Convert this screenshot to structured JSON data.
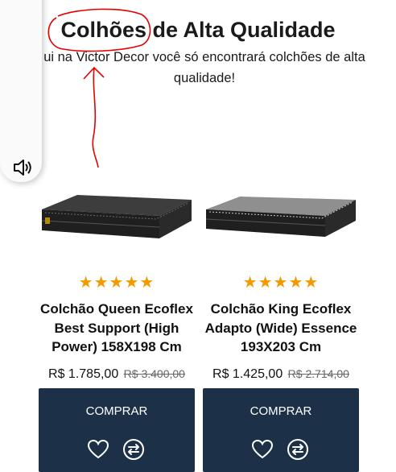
{
  "section": {
    "title": "Colhões de Alta Qualidade",
    "subtitle": "ui na Victor Decor você só encontrará colchões de alta qualidade!"
  },
  "side_panel": {
    "dots": "•••",
    "speaker_icon": "speaker-icon"
  },
  "products": [
    {
      "rating_stars": "★★★★★",
      "rating": 5,
      "name": "Colchão Queen Ecoflex Best Support (High Power) 158X198 Cm",
      "price": "R$ 1.785,00",
      "old_price": "R$ 3.400,00",
      "buy_label": "COMPRAR",
      "image_icon": "mattress-dark-image"
    },
    {
      "rating_stars": "★★★★★",
      "rating": 5,
      "name": "Colchão King Ecoflex Adapto (Wide) Essence 193X203 Cm",
      "price": "R$ 1.425,00",
      "old_price": "R$ 2.714,00",
      "buy_label": "COMPRAR",
      "image_icon": "mattress-grey-image"
    }
  ],
  "colors": {
    "buy_box": "#1c3148",
    "star": "#f29a00",
    "annotation": "#e60000"
  }
}
